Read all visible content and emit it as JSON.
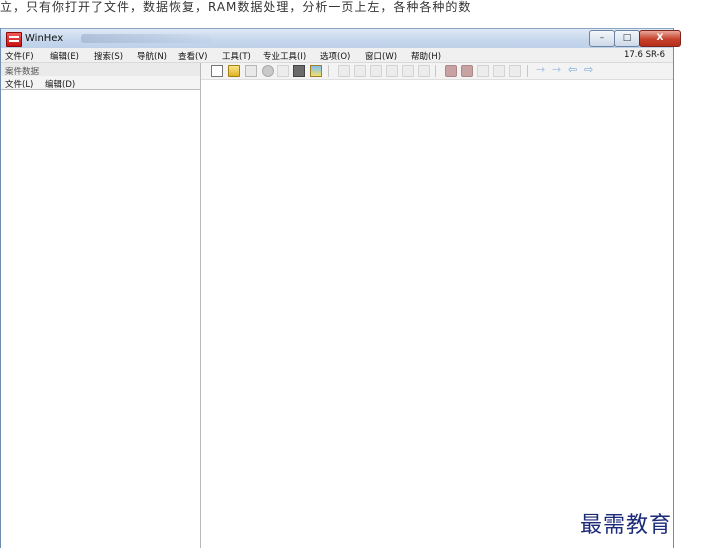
{
  "window": {
    "title": "WinHex",
    "version": "17.6 SR-6",
    "controls": {
      "minimize": "–",
      "maximize": "□",
      "close": "X"
    }
  },
  "menu": [
    "文件(F)",
    "编辑(E)",
    "搜索(S)",
    "导航(N)",
    "查看(V)",
    "工具(T)",
    "专业工具(I)",
    "选项(O)",
    "窗口(W)",
    "帮助(H)"
  ],
  "left_pane": {
    "title": "案件数据",
    "menu": [
      "文件(L)",
      "编辑(D)"
    ]
  },
  "toolbar": {
    "icons": [
      "new-file-icon",
      "open-file-icon",
      "save-icon",
      "open-disk-icon",
      "disabled-icon",
      "properties-icon",
      "image-icon",
      "undo-icon",
      "cut-icon",
      "copy-icon",
      "paste-icon",
      "paste-special-icon",
      "clipboard-icon",
      "find-text-icon",
      "find-hex-icon",
      "replace-text-icon",
      "replace-hex-icon",
      "goto-icon",
      "arrow-right-icon",
      "arrow-right-2-icon",
      "back-icon",
      "forward-icon"
    ]
  },
  "top_text": "立，只有你打开了文件，数据恢复，RAM数据处理，分析一页上左，各种各种的数",
  "watermark": "最需教育"
}
